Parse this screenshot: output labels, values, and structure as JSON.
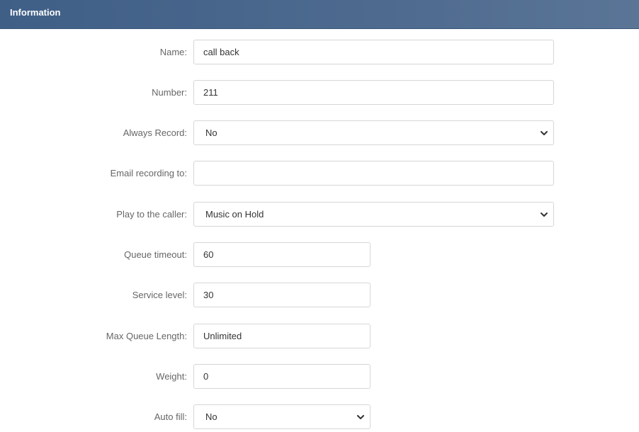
{
  "header": {
    "title": "Information"
  },
  "form": {
    "name": {
      "label": "Name:",
      "value": "call back"
    },
    "number": {
      "label": "Number:",
      "value": "211"
    },
    "always_record": {
      "label": "Always Record:",
      "value": "No"
    },
    "email_recording": {
      "label": "Email recording to:",
      "value": ""
    },
    "play_to_caller": {
      "label": "Play to the caller:",
      "value": "Music on Hold"
    },
    "queue_timeout": {
      "label": "Queue timeout:",
      "value": "60"
    },
    "service_level": {
      "label": "Service level:",
      "value": "30"
    },
    "max_queue_length": {
      "label": "Max Queue Length:",
      "value": "Unlimited"
    },
    "weight": {
      "label": "Weight:",
      "value": "0"
    },
    "auto_fill": {
      "label": "Auto fill:",
      "value": "No"
    }
  },
  "icons": {
    "dropdown": "chevron-down-icon"
  }
}
